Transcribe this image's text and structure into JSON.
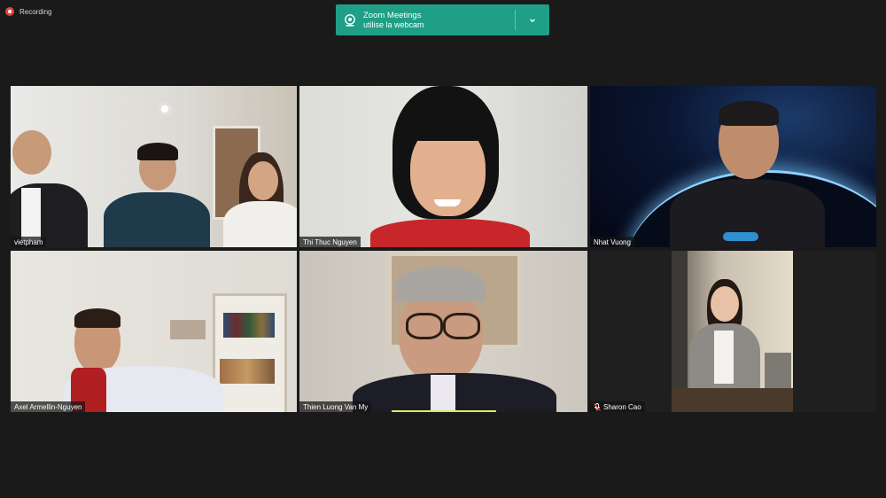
{
  "recording": {
    "label": "Recording"
  },
  "banner": {
    "title": "Zoom Meetings",
    "subtitle": "utilise la webcam",
    "icon": "webcam-icon",
    "accent": "#1f9f86"
  },
  "participants": [
    {
      "name": "vietpham",
      "muted": false,
      "active": false
    },
    {
      "name": "Thi Thuc Nguyen",
      "muted": false,
      "active": true
    },
    {
      "name": "Nhat Vuong",
      "muted": false,
      "active": false
    },
    {
      "name": "Axel Armellin-Nguyen",
      "muted": false,
      "active": false
    },
    {
      "name": "Thien Luong Van My",
      "muted": false,
      "active": false
    },
    {
      "name": "Sharon Cao",
      "muted": true,
      "active": false
    }
  ],
  "colors": {
    "active_border": "#d6ea6a",
    "background": "#1a1a1a"
  }
}
